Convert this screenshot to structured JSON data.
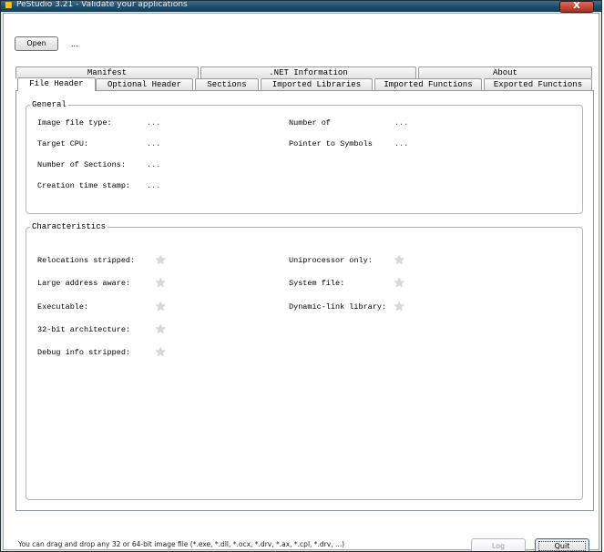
{
  "window": {
    "title": "PeStudio 3.21 - Validate your applications",
    "close_glyph": "X"
  },
  "toolbar": {
    "open_label": "Open",
    "file_path": "..."
  },
  "tabs": {
    "row1": [
      "Manifest",
      ".NET Information",
      "About"
    ],
    "row2": [
      "File Header",
      "Optional Header",
      "Sections",
      "Imported Libraries",
      "Imported Functions",
      "Exported Functions"
    ],
    "active": "File Header"
  },
  "general": {
    "legend": "General",
    "left": [
      {
        "label": "Image file type:",
        "value": "..."
      },
      {
        "label": "Target CPU:",
        "value": "..."
      },
      {
        "label": "Number of Sections:",
        "value": "..."
      },
      {
        "label": "Creation time stamp:",
        "value": "..."
      }
    ],
    "right": [
      {
        "label": "Number of",
        "value": "..."
      },
      {
        "label": "Pointer to Symbols",
        "value": "..."
      }
    ]
  },
  "characteristics": {
    "legend": "Characteristics",
    "left": [
      {
        "label": "Relocations stripped:",
        "icon": "star-icon"
      },
      {
        "label": "Large address aware:",
        "icon": "star-icon"
      },
      {
        "label": "Executable:",
        "icon": "star-icon"
      },
      {
        "label": "32-bit architecture:",
        "icon": "star-icon"
      },
      {
        "label": "Debug info stripped:",
        "icon": "star-icon"
      }
    ],
    "right": [
      {
        "label": "Uniprocessor only:",
        "icon": "star-icon"
      },
      {
        "label": "System file:",
        "icon": "star-icon"
      },
      {
        "label": "Dynamic-link library:",
        "icon": "star-icon"
      }
    ]
  },
  "footer": {
    "hint": "You can drag and drop any 32 or 64-bit image file (*.exe, *.dll, *.ocx, *.drv, *.ax, *.cpl, *.drv, ...)",
    "log_label": "Log",
    "quit_label": "Quit"
  }
}
